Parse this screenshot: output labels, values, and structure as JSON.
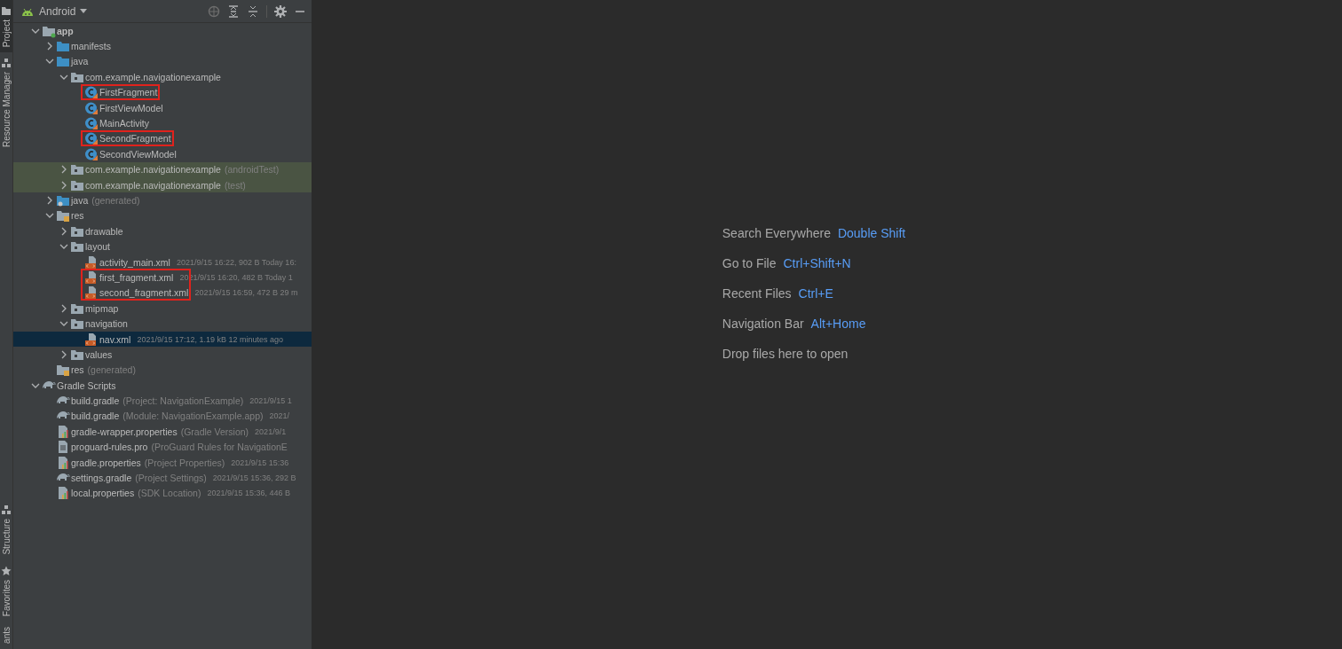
{
  "side_tabs_top": [
    {
      "label": "Project",
      "kind": "folder",
      "selected": true
    },
    {
      "label": "Resource Manager",
      "kind": "shapes",
      "selected": false
    }
  ],
  "side_tabs_bottom": [
    {
      "label": "Structure",
      "kind": "shapes",
      "selected": false
    },
    {
      "label": "Favorites",
      "kind": "star",
      "selected": false
    },
    {
      "label": "ants",
      "selected": false
    }
  ],
  "project_panel": {
    "view": "Android",
    "tree": [
      {
        "name": "app",
        "kind": "module",
        "bold": true,
        "expanded": true,
        "children": [
          {
            "name": "manifests",
            "kind": "folder",
            "expanded": false
          },
          {
            "name": "java",
            "kind": "folder",
            "expanded": true,
            "children": [
              {
                "name": "com.example.navigationexample",
                "kind": "package",
                "expanded": true,
                "children": [
                  {
                    "name": "FirstFragment",
                    "kind": "class",
                    "marked": true
                  },
                  {
                    "name": "FirstViewModel",
                    "kind": "class"
                  },
                  {
                    "name": "MainActivity",
                    "kind": "class"
                  },
                  {
                    "name": "SecondFragment",
                    "kind": "class",
                    "marked": true
                  },
                  {
                    "name": "SecondViewModel",
                    "kind": "class"
                  }
                ]
              },
              {
                "name": "com.example.navigationexample",
                "hint": "(androidTest)",
                "kind": "package",
                "expanded": false,
                "test_scope": true
              },
              {
                "name": "com.example.navigationexample",
                "hint": "(test)",
                "kind": "package",
                "expanded": false,
                "test_scope": true
              }
            ]
          },
          {
            "name": "java",
            "hint": "(generated)",
            "kind": "generated",
            "expanded": false
          },
          {
            "name": "res",
            "kind": "res",
            "expanded": true,
            "children": [
              {
                "name": "drawable",
                "kind": "package",
                "expanded": false
              },
              {
                "name": "layout",
                "kind": "package",
                "expanded": true,
                "children": [
                  {
                    "name": "activity_main.xml",
                    "meta": "2021/9/15 16:22, 902 B Today 16:",
                    "kind": "xml"
                  },
                  {
                    "name": "first_fragment.xml",
                    "meta": "2021/9/15 16:20, 482 B Today 1",
                    "kind": "xml",
                    "marked": true
                  },
                  {
                    "name": "second_fragment.xml",
                    "meta": "2021/9/15 16:59, 472 B 29 m",
                    "kind": "xml",
                    "marked": true
                  }
                ]
              },
              {
                "name": "mipmap",
                "kind": "package",
                "expanded": false
              },
              {
                "name": "navigation",
                "kind": "package",
                "expanded": true,
                "children": [
                  {
                    "name": "nav.xml",
                    "meta": "2021/9/15 17:12, 1.19 kB 12 minutes ago",
                    "kind": "xml",
                    "selected": true
                  }
                ]
              },
              {
                "name": "values",
                "kind": "package",
                "expanded": false
              }
            ]
          },
          {
            "name": "res",
            "hint": "(generated)",
            "kind": "res"
          }
        ]
      },
      {
        "name": "Gradle Scripts",
        "kind": "gradle",
        "expanded": true,
        "children": [
          {
            "name": "build.gradle",
            "hint": "(Project: NavigationExample)",
            "meta": "2021/9/15 1",
            "kind": "gradle"
          },
          {
            "name": "build.gradle",
            "hint": "(Module: NavigationExample.app)",
            "meta": "2021/",
            "kind": "gradle"
          },
          {
            "name": "gradle-wrapper.properties",
            "hint": "(Gradle Version)",
            "meta": "2021/9/1",
            "kind": "properties"
          },
          {
            "name": "proguard-rules.pro",
            "hint": "(ProGuard Rules for NavigationE",
            "kind": "text"
          },
          {
            "name": "gradle.properties",
            "hint": "(Project Properties)",
            "meta": "2021/9/15 15:36",
            "kind": "properties"
          },
          {
            "name": "settings.gradle",
            "hint": "(Project Settings)",
            "meta": "2021/9/15 15:36, 292 B",
            "kind": "gradle"
          },
          {
            "name": "local.properties",
            "hint": "(SDK Location)",
            "meta": "2021/9/15 15:36, 446 B",
            "kind": "properties"
          }
        ]
      }
    ]
  },
  "editor_hints": [
    {
      "label": "Search Everywhere",
      "shortcut": "Double Shift"
    },
    {
      "label": "Go to File",
      "shortcut": "Ctrl+Shift+N"
    },
    {
      "label": "Recent Files",
      "shortcut": "Ctrl+E"
    },
    {
      "label": "Navigation Bar",
      "shortcut": "Alt+Home"
    },
    {
      "label": "Drop files here to open"
    }
  ]
}
